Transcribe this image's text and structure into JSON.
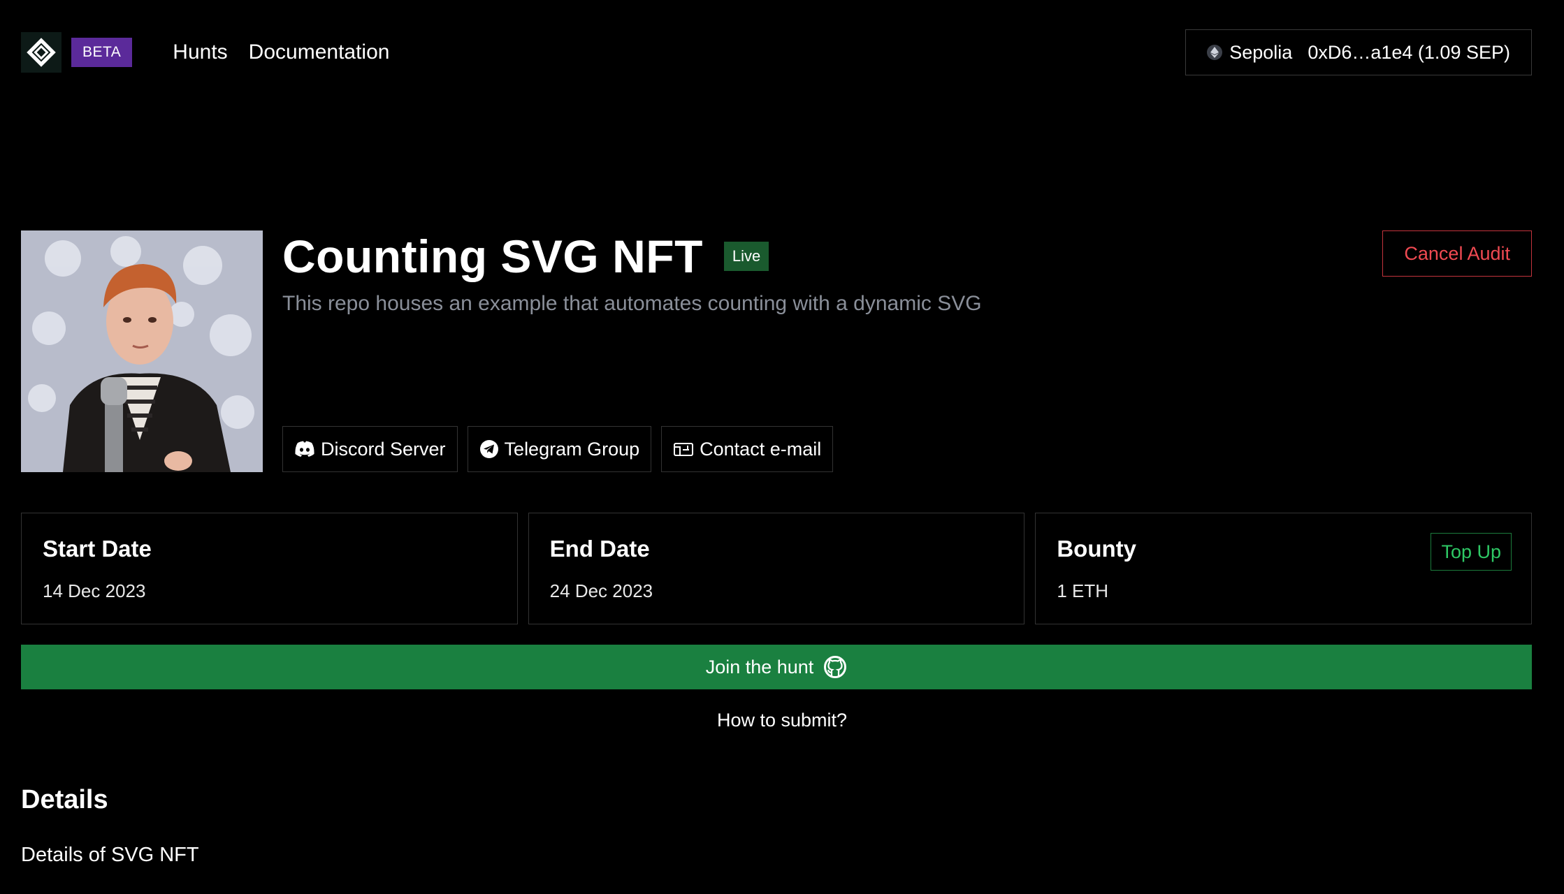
{
  "header": {
    "beta_label": "BETA",
    "nav": [
      {
        "label": "Hunts"
      },
      {
        "label": "Documentation"
      }
    ],
    "wallet": {
      "network": "Sepolia",
      "account": "0xD6…a1e4 (1.09 SEP)"
    }
  },
  "hunt": {
    "title": "Counting SVG NFT",
    "status": "Live",
    "description": "This repo houses an example that automates counting with a dynamic SVG",
    "cancel_label": "Cancel Audit",
    "links": [
      {
        "label": "Discord Server",
        "icon": "discord-icon"
      },
      {
        "label": "Telegram Group",
        "icon": "telegram-icon"
      },
      {
        "label": "Contact e-mail",
        "icon": "mail-icon"
      }
    ]
  },
  "cards": {
    "start": {
      "title": "Start Date",
      "value": "14 Dec 2023"
    },
    "end": {
      "title": "End Date",
      "value": "24 Dec 2023"
    },
    "bounty": {
      "title": "Bounty",
      "value": "1 ETH",
      "action": "Top Up"
    }
  },
  "join_label": "Join the hunt",
  "howto_label": "How to submit?",
  "details": {
    "heading": "Details",
    "text": "Details of SVG NFT"
  },
  "colors": {
    "background": "#000000",
    "accent_green": "#1a8040",
    "live_green": "#1a5a2e",
    "danger_red": "#f04a52",
    "beta_purple": "#5b2a9a",
    "muted_text": "#8a8f99"
  }
}
